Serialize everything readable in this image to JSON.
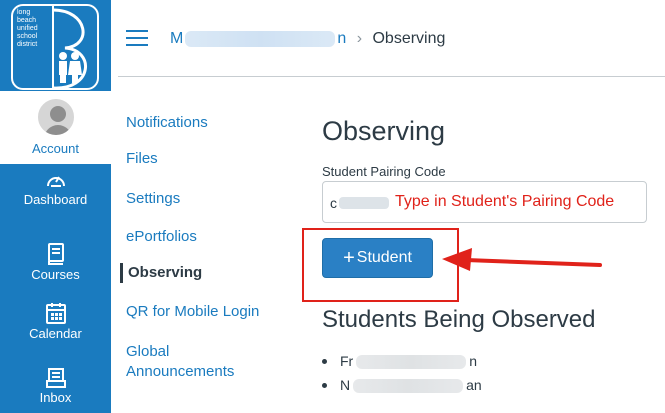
{
  "logo": {
    "lines": [
      "long",
      "beach",
      "unified",
      "school",
      "district"
    ]
  },
  "global_nav": {
    "account": "Account",
    "dashboard": "Dashboard",
    "courses": "Courses",
    "calendar": "Calendar",
    "inbox": "Inbox"
  },
  "header": {
    "crumb_start": "M",
    "crumb_end": "n",
    "separator": "›",
    "current": "Observing"
  },
  "subnav": {
    "notifications": "Notifications",
    "files": "Files",
    "settings": "Settings",
    "eportfolios": "ePortfolios",
    "observing": "Observing",
    "qr": "QR for Mobile Login",
    "global1": "Global",
    "global2": "Announcements"
  },
  "main": {
    "title": "Observing",
    "code_label": "Student Pairing Code",
    "code_value": "c",
    "code_overlay": "Type in Student's Pairing Code",
    "button_plus": "+",
    "button_label": "Student",
    "subtitle": "Students Being Observed",
    "students": [
      {
        "start": "Fr",
        "end": "n"
      },
      {
        "start": "N",
        "end": "an"
      }
    ]
  },
  "colors": {
    "brand": "#1a7bbf",
    "button": "#2a80c5",
    "annotation": "#e0221a"
  }
}
